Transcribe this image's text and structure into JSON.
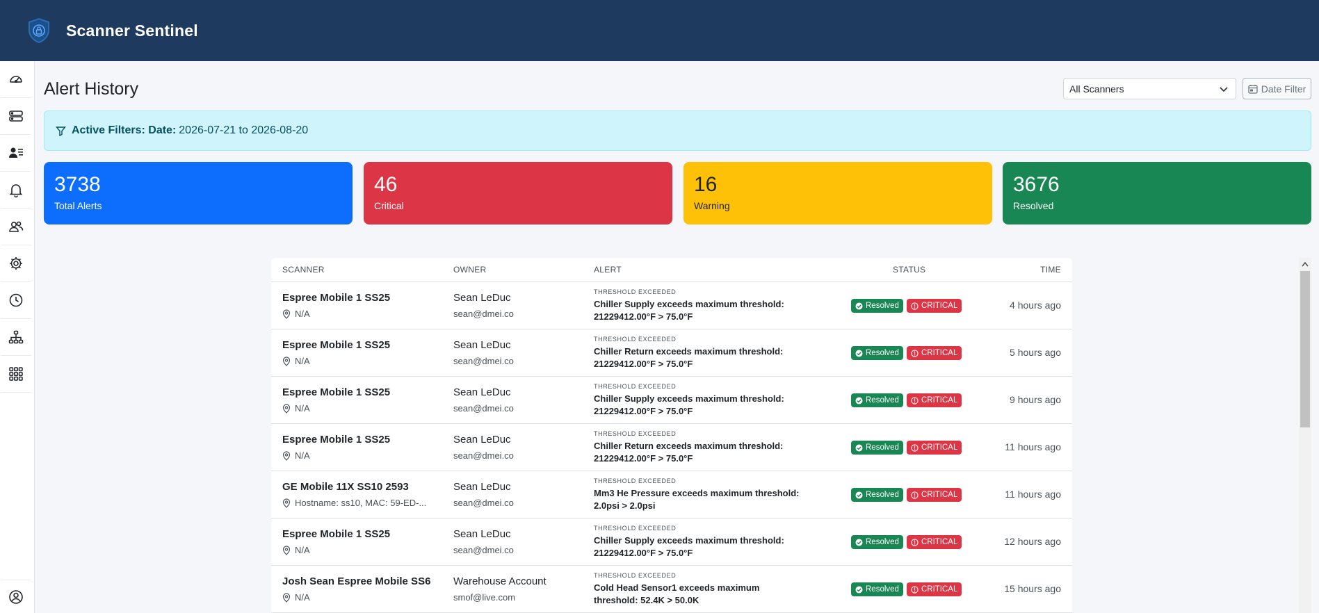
{
  "app": {
    "title": "Scanner Sentinel"
  },
  "sidebar": {
    "items": [
      {
        "icon": "speedometer-icon"
      },
      {
        "icon": "servers-icon"
      },
      {
        "icon": "person-lines-icon"
      },
      {
        "icon": "bell-icon"
      },
      {
        "icon": "people-icon"
      },
      {
        "icon": "gear-icon"
      },
      {
        "icon": "clock-history-icon"
      },
      {
        "icon": "diagram-icon"
      },
      {
        "icon": "grid-icon"
      }
    ],
    "bottom_icon": "user-circle-icon"
  },
  "page": {
    "title": "Alert History",
    "scanner_select": "All Scanners",
    "date_filter_label": "Date Filter"
  },
  "filter_banner": {
    "label": "Active Filters: Date:",
    "value": "2026-07-21 to 2026-08-20"
  },
  "stats": {
    "total": {
      "value": "3738",
      "label": "Total Alerts"
    },
    "critical": {
      "value": "46",
      "label": "Critical"
    },
    "warning": {
      "value": "16",
      "label": "Warning"
    },
    "resolved": {
      "value": "3676",
      "label": "Resolved"
    }
  },
  "table": {
    "headers": {
      "scanner": "SCANNER",
      "owner": "OWNER",
      "alert": "ALERT",
      "status": "STATUS",
      "time": "TIME"
    },
    "rows": [
      {
        "scanner": "Espree Mobile 1 SS25",
        "location": "N/A",
        "owner": "Sean LeDuc",
        "email": "sean@dmei.co",
        "alert_type": "THRESHOLD EXCEEDED",
        "alert": "Chiller Supply exceeds maximum threshold: 21229412.00°F > 75.0°F",
        "status": "Resolved",
        "severity": "CRITICAL",
        "time": "4 hours ago"
      },
      {
        "scanner": "Espree Mobile 1 SS25",
        "location": "N/A",
        "owner": "Sean LeDuc",
        "email": "sean@dmei.co",
        "alert_type": "THRESHOLD EXCEEDED",
        "alert": "Chiller Return exceeds maximum threshold: 21229412.00°F > 75.0°F",
        "status": "Resolved",
        "severity": "CRITICAL",
        "time": "5 hours ago"
      },
      {
        "scanner": "Espree Mobile 1 SS25",
        "location": "N/A",
        "owner": "Sean LeDuc",
        "email": "sean@dmei.co",
        "alert_type": "THRESHOLD EXCEEDED",
        "alert": "Chiller Supply exceeds maximum threshold: 21229412.00°F > 75.0°F",
        "status": "Resolved",
        "severity": "CRITICAL",
        "time": "9 hours ago"
      },
      {
        "scanner": "Espree Mobile 1 SS25",
        "location": "N/A",
        "owner": "Sean LeDuc",
        "email": "sean@dmei.co",
        "alert_type": "THRESHOLD EXCEEDED",
        "alert": "Chiller Return exceeds maximum threshold: 21229412.00°F > 75.0°F",
        "status": "Resolved",
        "severity": "CRITICAL",
        "time": "11 hours ago"
      },
      {
        "scanner": "GE Mobile 11X SS10 2593",
        "location": "Hostname: ss10, MAC: 59-ED-...",
        "owner": "Sean LeDuc",
        "email": "sean@dmei.co",
        "alert_type": "THRESHOLD EXCEEDED",
        "alert": "Mm3 He Pressure exceeds maximum threshold: 2.0psi > 2.0psi",
        "status": "Resolved",
        "severity": "CRITICAL",
        "time": "11 hours ago"
      },
      {
        "scanner": "Espree Mobile 1 SS25",
        "location": "N/A",
        "owner": "Sean LeDuc",
        "email": "sean@dmei.co",
        "alert_type": "THRESHOLD EXCEEDED",
        "alert": "Chiller Supply exceeds maximum threshold: 21229412.00°F > 75.0°F",
        "status": "Resolved",
        "severity": "CRITICAL",
        "time": "12 hours ago"
      },
      {
        "scanner": "Josh Sean Espree Mobile SS6",
        "location": "N/A",
        "owner": "Warehouse Account",
        "email": "smof@live.com",
        "alert_type": "THRESHOLD EXCEEDED",
        "alert": "Cold Head Sensor1 exceeds maximum threshold: 52.4K > 50.0K",
        "status": "Resolved",
        "severity": "CRITICAL",
        "time": "15 hours ago"
      }
    ]
  }
}
